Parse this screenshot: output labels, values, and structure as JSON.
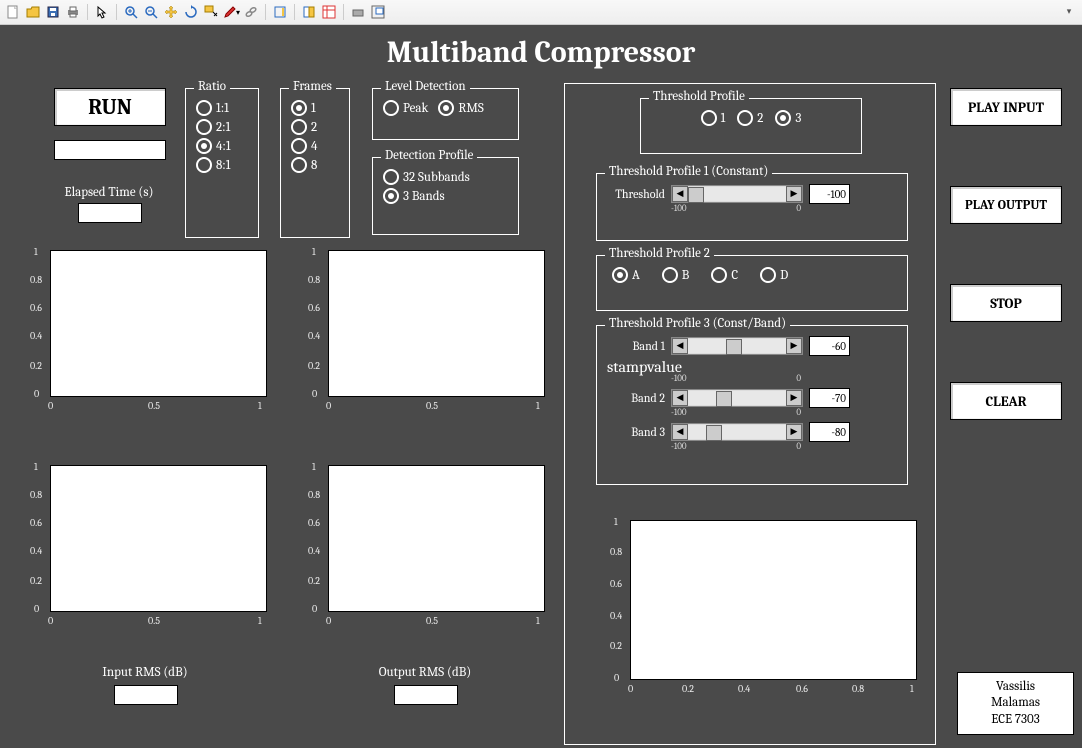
{
  "title": "Multiband Compressor",
  "toolbar_icons": [
    "new",
    "open",
    "save",
    "print",
    "pointer",
    "zoom-in",
    "zoom-out",
    "pan",
    "rotate",
    "data-cursor",
    "brush",
    "link",
    "insert-colorbar",
    "insert-legend",
    "hide-plot",
    "dock"
  ],
  "run_button": "RUN",
  "elapsed_label": "Elapsed Time (s)",
  "ratio": {
    "legend": "Ratio",
    "options": [
      "1:1",
      "2:1",
      "4:1",
      "8:1"
    ],
    "selected": "4:1"
  },
  "frames": {
    "legend": "Frames",
    "options": [
      "1",
      "2",
      "4",
      "8"
    ],
    "selected": "1"
  },
  "level_detection": {
    "legend": "Level Detection",
    "options": [
      "Peak",
      "RMS"
    ],
    "selected": "RMS"
  },
  "detection_profile": {
    "legend": "Detection Profile",
    "options": [
      "32 Subbands",
      "3 Bands"
    ],
    "selected": "3 Bands"
  },
  "threshold_profile": {
    "legend": "Threshold Profile",
    "options": [
      "1",
      "2",
      "3"
    ],
    "selected": "3"
  },
  "tp1": {
    "legend": "Threshold Profile 1 (Constant)",
    "label": "Threshold",
    "min_label": "-100",
    "max_label": "0",
    "value": "-100"
  },
  "tp2": {
    "legend": "Threshold Profile 2",
    "options": [
      "A",
      "B",
      "C",
      "D"
    ],
    "selected": "A"
  },
  "tp3": {
    "legend": "Threshold Profile 3 (Const/Band)",
    "bands": [
      {
        "label": "Band 1",
        "value": "-60"
      },
      {
        "label": "Band 2",
        "value": "-70"
      },
      {
        "label": "Band 3",
        "value": "-80"
      }
    ],
    "min_label": "-100",
    "max_label": "0"
  },
  "actions": {
    "play_input": "PLAY INPUT",
    "play_output": "PLAY OUTPUT",
    "stop": "STOP",
    "clear": "CLEAR"
  },
  "plot_labels": {
    "input_rms": "Input RMS (dB)",
    "output_rms": "Output RMS (dB)"
  },
  "xticks": [
    "0",
    "0.5",
    "1"
  ],
  "xticks5": [
    "0",
    "0.2",
    "0.4",
    "0.6",
    "0.8",
    "1"
  ],
  "yticks": [
    "0",
    "0.2",
    "0.4",
    "0.6",
    "0.8",
    "1"
  ],
  "credit": {
    "line1": "Vassilis",
    "line2": "Malamas",
    "line3": "ECE 7303"
  }
}
